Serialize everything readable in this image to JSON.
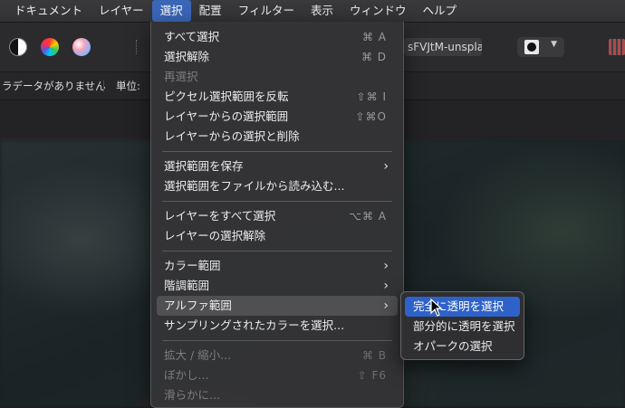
{
  "menubar": {
    "items": [
      "ドキュメント",
      "レイヤー",
      "選択",
      "配置",
      "フィルター",
      "表示",
      "ウィンドウ",
      "ヘルプ"
    ],
    "active_index": 2
  },
  "toolbar": {
    "document_name": "sFVJtM-unspla",
    "icons": [
      "contrast-icon",
      "color-wheel-icon",
      "hsl-icon",
      "grid-icon"
    ]
  },
  "context_bar": {
    "metadata_text": "ラデータがありません",
    "unit_label": "単位:"
  },
  "select_menu": {
    "items": [
      {
        "label": "すべて選択",
        "shortcut": "⌘ A",
        "enabled": true
      },
      {
        "label": "選択解除",
        "shortcut": "⌘ D",
        "enabled": true
      },
      {
        "label": "再選択",
        "shortcut": "",
        "enabled": false
      },
      {
        "label": "ピクセル選択範囲を反転",
        "shortcut": "⇧⌘ I",
        "enabled": true
      },
      {
        "label": "レイヤーからの選択範囲",
        "shortcut": "⇧⌘O",
        "enabled": true
      },
      {
        "label": "レイヤーからの選択と削除",
        "shortcut": "",
        "enabled": true
      },
      {
        "label": "選択範囲を保存",
        "submenu": true,
        "enabled": true
      },
      {
        "label": "選択範囲をファイルから読み込む...",
        "shortcut": "",
        "enabled": true
      },
      {
        "label": "レイヤーをすべて選択",
        "shortcut": "⌥⌘ A",
        "enabled": true
      },
      {
        "label": "レイヤーの選択解除",
        "shortcut": "",
        "enabled": true
      },
      {
        "label": "カラー範囲",
        "submenu": true,
        "enabled": true
      },
      {
        "label": "階調範囲",
        "submenu": true,
        "enabled": true
      },
      {
        "label": "アルファ範囲",
        "submenu": true,
        "enabled": true,
        "highlighted": true
      },
      {
        "label": "サンプリングされたカラーを選択...",
        "shortcut": "",
        "enabled": true
      },
      {
        "label": "拡大 / 縮小...",
        "shortcut": "⌘ B",
        "enabled": false
      },
      {
        "label": "ぼかし...",
        "shortcut": "⇧ F6",
        "enabled": false
      },
      {
        "label": "滑らかに...",
        "shortcut": "",
        "enabled": false
      }
    ]
  },
  "alpha_submenu": {
    "items": [
      "完全に透明を選択",
      "部分的に透明を選択",
      "オパークの選択"
    ],
    "selected_index": 0
  }
}
